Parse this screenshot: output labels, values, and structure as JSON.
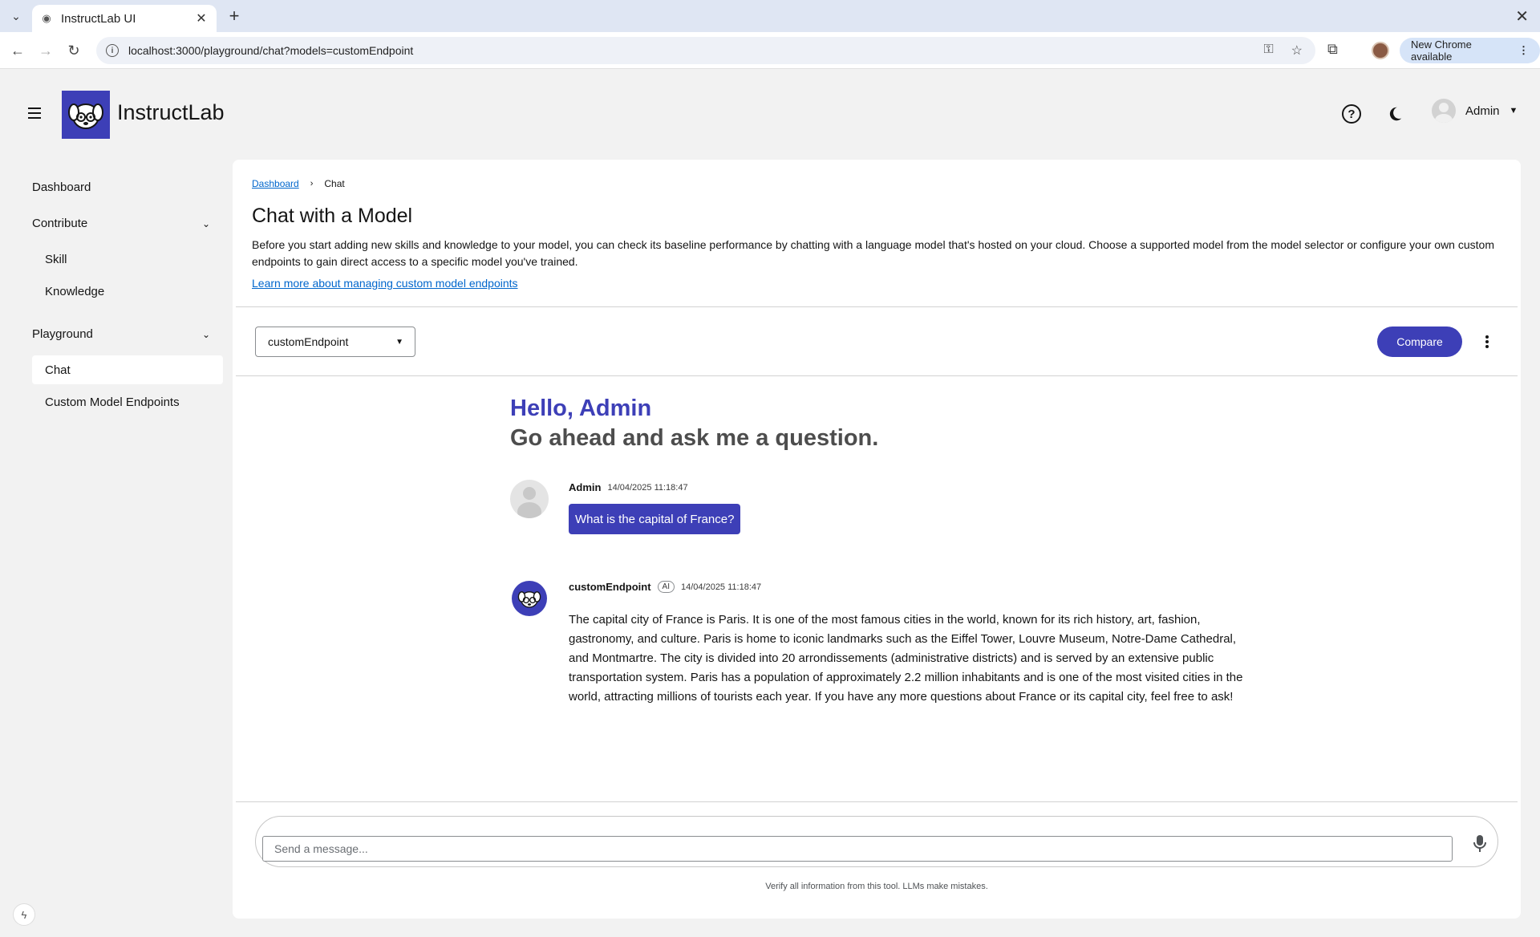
{
  "browser": {
    "tab_title": "InstructLab UI",
    "url": "localhost:3000/playground/chat?models=customEndpoint",
    "update_label": "New Chrome available"
  },
  "masthead": {
    "brand": "InstructLab",
    "user_name": "Admin"
  },
  "sidebar": {
    "dashboard": "Dashboard",
    "contribute": "Contribute",
    "skill": "Skill",
    "knowledge": "Knowledge",
    "playground": "Playground",
    "chat": "Chat",
    "custom_endpoints": "Custom Model Endpoints"
  },
  "page": {
    "breadcrumb_root": "Dashboard",
    "breadcrumb_current": "Chat",
    "title": "Chat with a Model",
    "description": "Before you start adding new skills and knowledge to your model, you can check its baseline performance by chatting with a language model that's hosted on your cloud. Choose a supported model from the model selector or configure your own custom endpoints to gain direct access to a specific model you've trained.",
    "learn_link": "Learn more about managing custom model endpoints"
  },
  "controls": {
    "selected_model": "customEndpoint",
    "compare_label": "Compare"
  },
  "chat": {
    "greeting": "Hello, Admin",
    "prompt": "Go ahead and ask me a question.",
    "messages": [
      {
        "author": "Admin",
        "timestamp": "14/04/2025 11:18:47",
        "text": "What is the capital of France?"
      },
      {
        "author": "customEndpoint",
        "badge": "AI",
        "timestamp": "14/04/2025 11:18:47",
        "text": "The capital city of France is Paris. It is one of the most famous cities in the world, known for its rich history, art, fashion, gastronomy, and culture. Paris is home to iconic landmarks such as the Eiffel Tower, Louvre Museum, Notre-Dame Cathedral, and Montmartre. The city is divided into 20 arrondissements (administrative districts) and is served by an extensive public transportation system. Paris has a population of approximately 2.2 million inhabitants and is one of the most visited cities in the world, attracting millions of tourists each year. If you have any more questions about France or its capital city, feel free to ask!"
      }
    ],
    "input_placeholder": "Send a message...",
    "disclaimer": "Verify all information from this tool. LLMs make mistakes."
  },
  "colors": {
    "accent": "#3d3fb7",
    "link": "#0066cc",
    "page_bg": "#f2f2f2"
  }
}
